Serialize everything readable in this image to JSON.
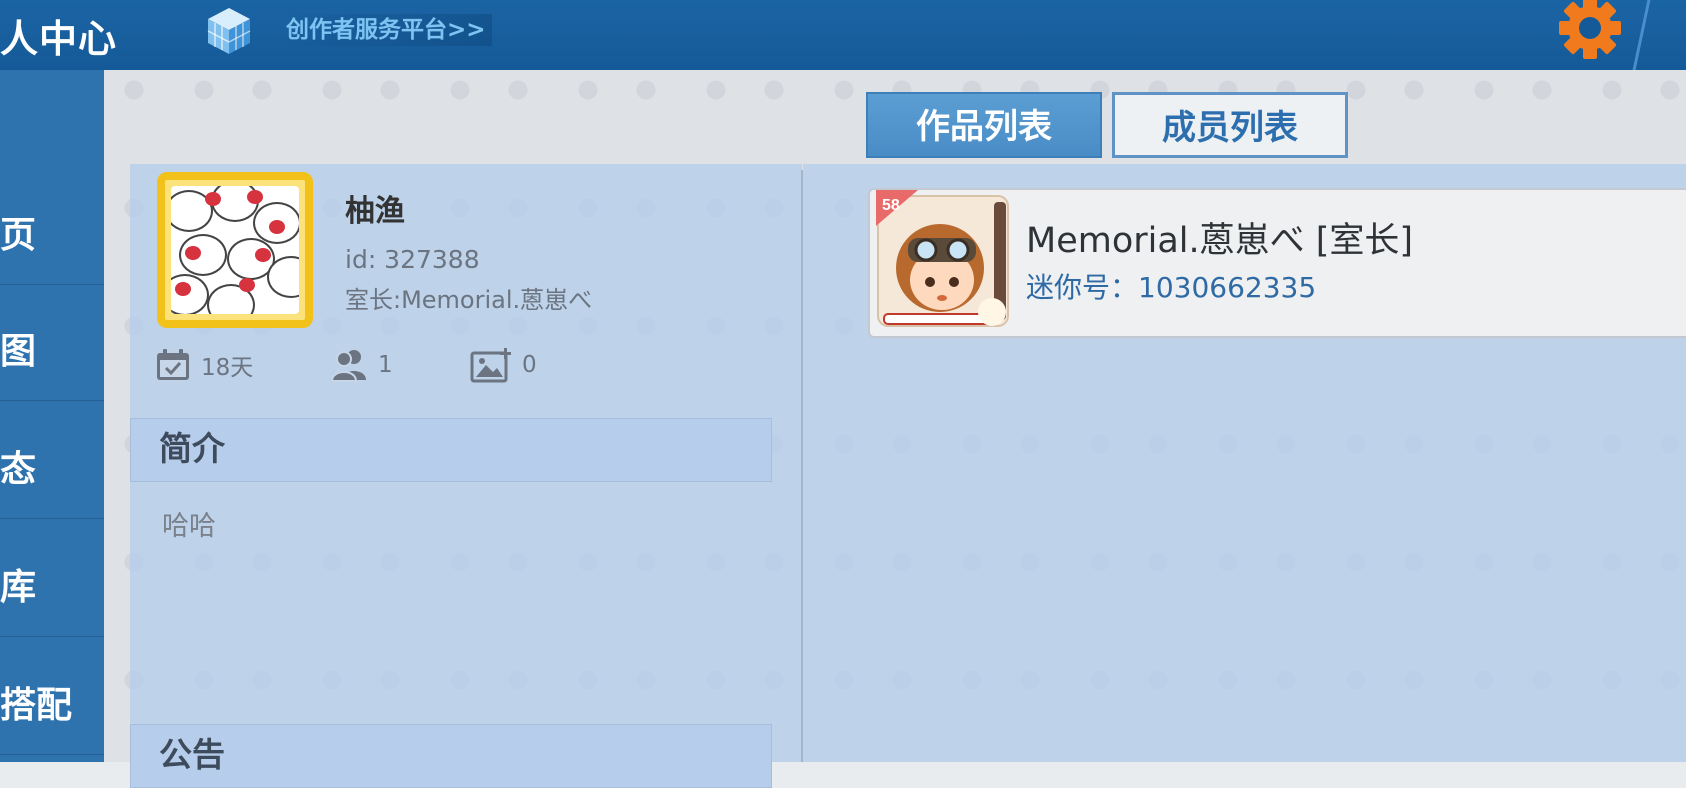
{
  "header": {
    "title": "人中心",
    "creator_link": "创作者服务平台>>",
    "cube_icon": "cube-icon",
    "settings_icon": "gear-icon"
  },
  "sidebar": {
    "items": [
      {
        "label": "页"
      },
      {
        "label": "图"
      },
      {
        "label": "态"
      },
      {
        "label": "库"
      },
      {
        "label": "搭配"
      }
    ]
  },
  "tabs": {
    "works": "作品列表",
    "members": "成员列表"
  },
  "profile": {
    "name": "柚渔",
    "id_text": "id: 327388",
    "owner_text": "室长:Memorial.蒽崽べ",
    "stats": {
      "days": "18天",
      "members": "1",
      "works": "0"
    }
  },
  "sections": {
    "intro_title": "简介",
    "intro_text": "哈哈",
    "notice_title": "公告"
  },
  "member_list": [
    {
      "name": "Memorial.蒽崽べ [室长]",
      "mini_number": "迷你号：1030662335",
      "badge": "58"
    }
  ],
  "colors": {
    "topbar": "#155a98",
    "sidebar": "#2e72ae",
    "accent_link": "#7ec4f3",
    "gear": "#f07a1c",
    "avatar_frame": "#f2c21a"
  }
}
